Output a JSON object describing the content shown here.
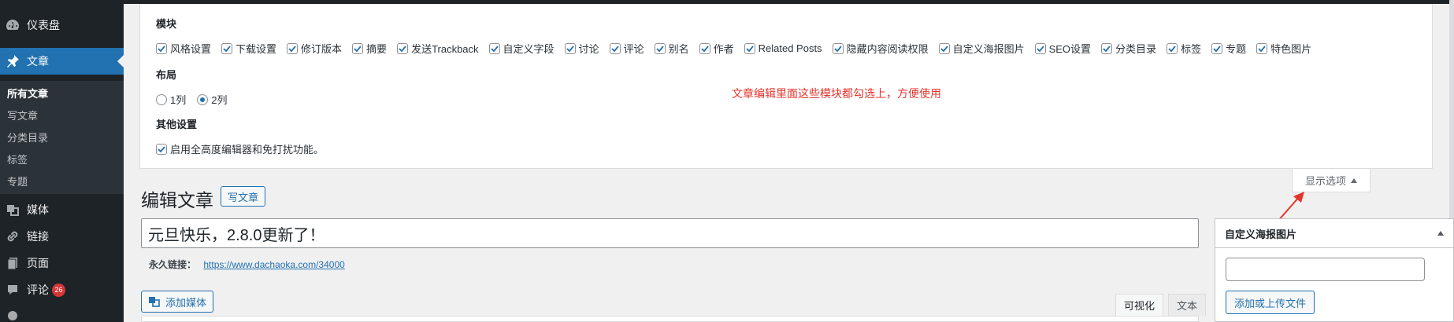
{
  "sidebar": {
    "dashboard": "仪表盘",
    "posts": "文章",
    "submenu": [
      "所有文章",
      "写文章",
      "分类目录",
      "标签",
      "专题"
    ],
    "media": "媒体",
    "links": "链接",
    "pages": "页面",
    "comments": "评论",
    "comments_badge": "26"
  },
  "screen_options": {
    "modules_heading": "模块",
    "modules": [
      {
        "label": "风格设置",
        "checked": true
      },
      {
        "label": "下载设置",
        "checked": true
      },
      {
        "label": "修订版本",
        "checked": true
      },
      {
        "label": "摘要",
        "checked": true
      },
      {
        "label": "发送Trackback",
        "checked": true
      },
      {
        "label": "自定义字段",
        "checked": true
      },
      {
        "label": "讨论",
        "checked": true
      },
      {
        "label": "评论",
        "checked": true
      },
      {
        "label": "别名",
        "checked": true
      },
      {
        "label": "作者",
        "checked": true
      },
      {
        "label": "Related Posts",
        "checked": true
      },
      {
        "label": "隐藏内容阅读权限",
        "checked": true
      },
      {
        "label": "自定义海报图片",
        "checked": true
      },
      {
        "label": "SEO设置",
        "checked": true
      },
      {
        "label": "分类目录",
        "checked": true
      },
      {
        "label": "标签",
        "checked": true
      },
      {
        "label": "专题",
        "checked": true
      },
      {
        "label": "特色图片",
        "checked": true
      }
    ],
    "layout_heading": "布局",
    "layout_options": [
      {
        "label": "1列",
        "selected": false
      },
      {
        "label": "2列",
        "selected": true
      }
    ],
    "other_heading": "其他设置",
    "other_option": "启用全高度编辑器和免打扰功能。",
    "annotation": "文章编辑里面这些模块都勾选上，方便使用",
    "annotation_color": "#e5342c",
    "tab_label": "显示选项"
  },
  "editor": {
    "page_title": "编辑文章",
    "add_new": "写文章",
    "post_title": "元旦快乐，2.8.0更新了！",
    "permalink_label": "永久链接：",
    "permalink_url": "https://www.dachaoka.com/34000",
    "add_media": "添加媒体",
    "tab_visual": "可视化",
    "tab_text": "文本"
  },
  "metabox": {
    "title": "自定义海报图片",
    "input_value": "",
    "upload_button": "添加或上传文件"
  },
  "colors": {
    "accent": "#2271b1",
    "sidebar_bg": "#1d2327"
  }
}
